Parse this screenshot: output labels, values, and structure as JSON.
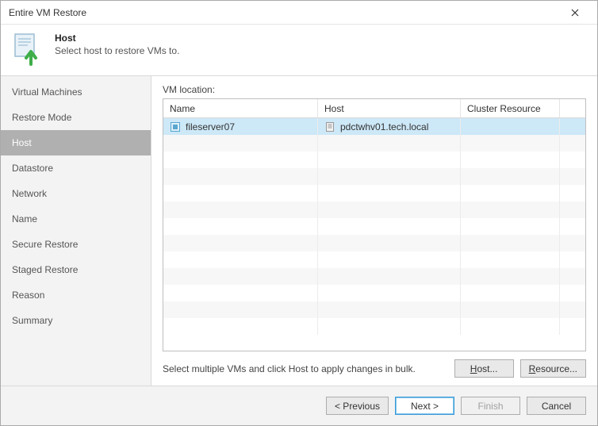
{
  "window": {
    "title": "Entire VM Restore"
  },
  "header": {
    "title": "Host",
    "subtitle": "Select host to restore VMs to."
  },
  "sidebar": {
    "items": [
      {
        "label": "Virtual Machines",
        "key": "virtual-machines"
      },
      {
        "label": "Restore Mode",
        "key": "restore-mode"
      },
      {
        "label": "Host",
        "key": "host"
      },
      {
        "label": "Datastore",
        "key": "datastore"
      },
      {
        "label": "Network",
        "key": "network"
      },
      {
        "label": "Name",
        "key": "name"
      },
      {
        "label": "Secure Restore",
        "key": "secure-restore"
      },
      {
        "label": "Staged Restore",
        "key": "staged-restore"
      },
      {
        "label": "Reason",
        "key": "reason"
      },
      {
        "label": "Summary",
        "key": "summary"
      }
    ],
    "active_key": "host"
  },
  "main": {
    "section_label": "VM location:",
    "columns": {
      "name": "Name",
      "host": "Host",
      "cluster": "Cluster Resource"
    },
    "rows": [
      {
        "name": "fileserver07",
        "host": "pdctwhv01.tech.local",
        "cluster": ""
      }
    ],
    "hint": "Select multiple VMs and click Host to apply changes in bulk.",
    "buttons": {
      "host": "Host...",
      "resource": "Resource..."
    }
  },
  "footer": {
    "previous": "< Previous",
    "next": "Next >",
    "finish": "Finish",
    "cancel": "Cancel"
  }
}
